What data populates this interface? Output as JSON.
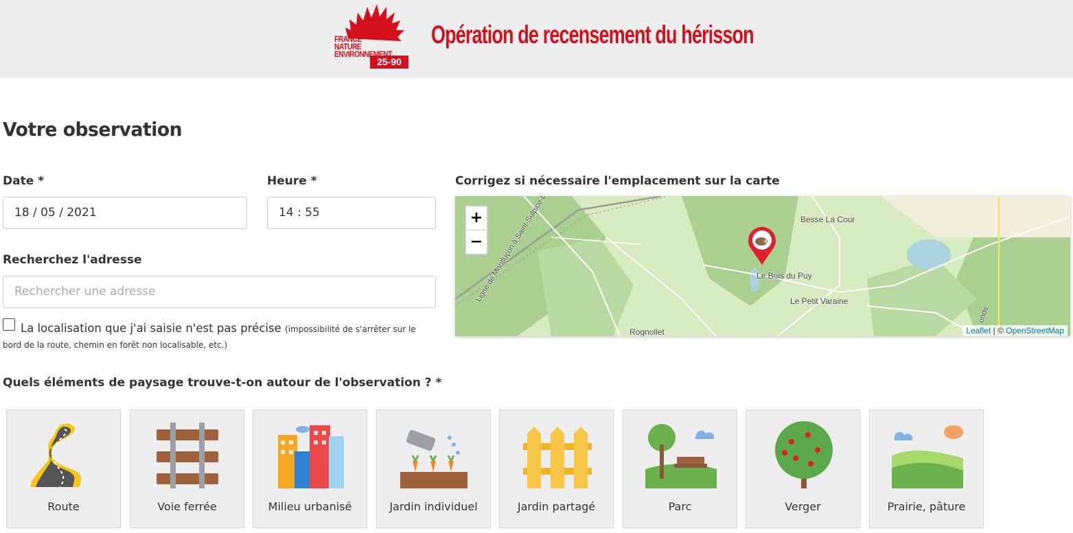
{
  "header": {
    "logo_line1": "FRANCE NATURE",
    "logo_line2": "ENVIRONNEMENT",
    "logo_badge": "25-90",
    "title": "Opération de recensement du hérisson",
    "brand_color": "#d4101c"
  },
  "section_title": "Votre observation",
  "form": {
    "date_label": "Date *",
    "date_value": "18 / 05 / 2021",
    "time_label": "Heure *",
    "time_value": "14 : 55",
    "address_label": "Recherchez l'adresse",
    "address_placeholder": "Rechercher une adresse",
    "imprecise_label": "La localisation que j'ai saisie n'est pas précise",
    "imprecise_note_1": "(impossibilité de s'arrêter sur le",
    "imprecise_note_2": "bord de la route, chemin en forêt non localisable, etc.)",
    "imprecise_checked": false
  },
  "map": {
    "label": "Corrigez si nécessaire l'emplacement sur la carte",
    "zoom_in": "+",
    "zoom_out": "−",
    "places": {
      "besse": "Besse La Cour",
      "bois": "Le Bois du Puy",
      "varaine": "Le Petit Varaine",
      "rognollet": "Rognollet",
      "railway": "Ligne de Montluçon à Saint-Sulpice-Laurière",
      "onds": "onds"
    },
    "attribution_leaflet": "Leaflet",
    "attribution_sep": " | © ",
    "attribution_osm": "OpenStreetMap"
  },
  "landscape": {
    "question": "Quels éléments de paysage trouve-t-on autour de l'observation ? *",
    "options": [
      {
        "label": "Route",
        "icon": "road-icon"
      },
      {
        "label": "Voie ferrée",
        "icon": "railway-icon"
      },
      {
        "label": "Milieu urbanisé",
        "icon": "city-icon"
      },
      {
        "label": "Jardin individuel",
        "icon": "garden-icon"
      },
      {
        "label": "Jardin partagé",
        "icon": "fence-icon"
      },
      {
        "label": "Parc",
        "icon": "park-icon"
      },
      {
        "label": "Verger",
        "icon": "orchard-tree-icon"
      },
      {
        "label": "Prairie, pâture",
        "icon": "meadow-icon"
      }
    ]
  }
}
